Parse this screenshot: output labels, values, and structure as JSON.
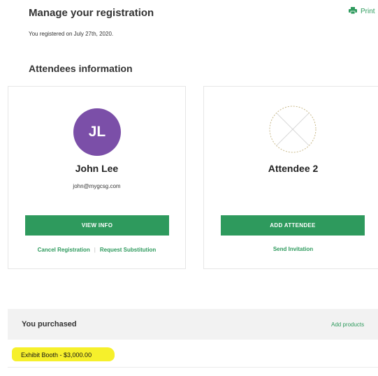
{
  "header": {
    "title": "Manage your registration",
    "print_label": "Print",
    "registered_text": "You registered on July 27th, 2020."
  },
  "attendees": {
    "section_title": "Attendees information",
    "cards": [
      {
        "initials": "JL",
        "name": "John Lee",
        "email": "john@mygcsg.com",
        "button_label": "VIEW INFO",
        "link_1": "Cancel Registration",
        "separator": "|",
        "link_2": "Request Substitution"
      },
      {
        "name": "Attendee 2",
        "button_label": "ADD ATTENDEE",
        "link_1": "Send Invitation"
      }
    ]
  },
  "purchased": {
    "title": "You purchased",
    "add_products_label": "Add products",
    "items": [
      {
        "label": "Exhibit Booth - $3,000.00"
      }
    ]
  },
  "colors": {
    "accent": "#2e9a5d",
    "avatar": "#7b4fa8",
    "highlight": "#f6f02b",
    "panel": "#f2f2f2"
  },
  "icons": {
    "print": "printer-icon",
    "empty_avatar": "empty-avatar-icon"
  }
}
